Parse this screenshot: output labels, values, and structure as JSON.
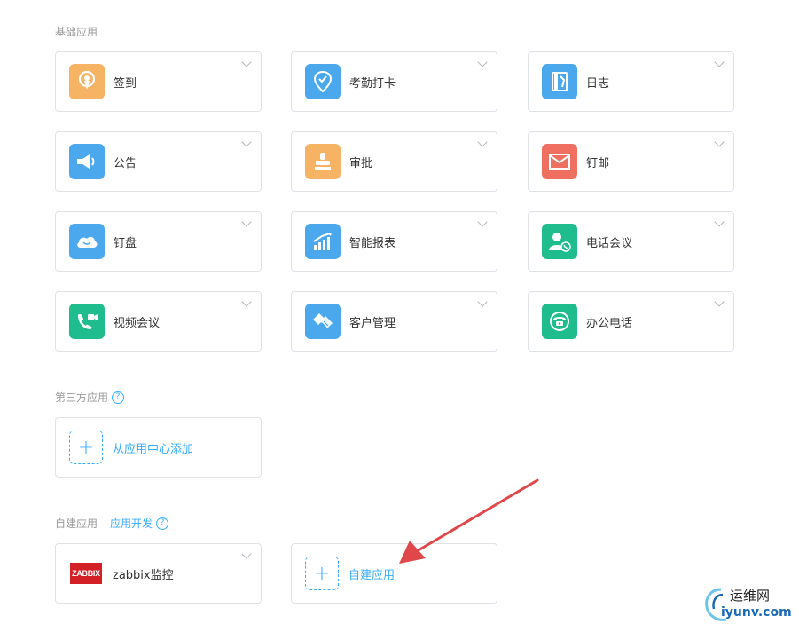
{
  "sections": {
    "basic": {
      "title": "基础应用"
    },
    "third_party": {
      "title": "第三方应用",
      "help": "?"
    },
    "custom": {
      "title": "自建应用",
      "link": "应用开发",
      "help": "?"
    }
  },
  "basic_apps": [
    {
      "label": "签到",
      "icon": "location-pin-icon",
      "color": "#f5b363"
    },
    {
      "label": "考勤打卡",
      "icon": "location-check-icon",
      "color": "#4ba8ec"
    },
    {
      "label": "日志",
      "icon": "notebook-icon",
      "color": "#4ba8ec"
    },
    {
      "label": "公告",
      "icon": "megaphone-icon",
      "color": "#4ba8ec"
    },
    {
      "label": "审批",
      "icon": "stamp-icon",
      "color": "#f5b363"
    },
    {
      "label": "钉邮",
      "icon": "mail-icon",
      "color": "#ef7060"
    },
    {
      "label": "钉盘",
      "icon": "cloud-icon",
      "color": "#4ba8ec"
    },
    {
      "label": "智能报表",
      "icon": "chart-icon",
      "color": "#4ba8ec"
    },
    {
      "label": "电话会议",
      "icon": "contact-phone-icon",
      "color": "#1fbc8d"
    },
    {
      "label": "视频会议",
      "icon": "video-call-icon",
      "color": "#1fbc8d"
    },
    {
      "label": "客户管理",
      "icon": "handshake-icon",
      "color": "#4ba8ec"
    },
    {
      "label": "办公电话",
      "icon": "telephone-icon",
      "color": "#1fbc8d"
    }
  ],
  "third_party_add": {
    "label": "从应用中心添加",
    "symbol": "+"
  },
  "custom_apps": {
    "zabbix": {
      "logo_text": "ZABBIX",
      "label": "zabbix监控"
    },
    "add": {
      "label": "自建应用",
      "symbol": "+"
    }
  },
  "watermark": {
    "line1": "运维网",
    "line2": "iyunv.com"
  },
  "colors": {
    "accent": "#38adff",
    "arrow": "#e0474b"
  }
}
